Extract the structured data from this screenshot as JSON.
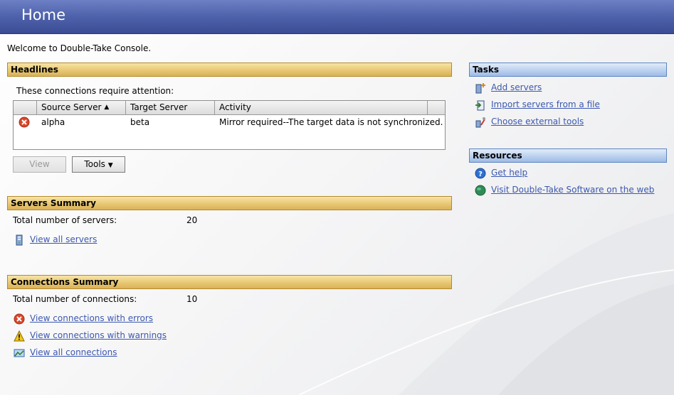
{
  "header": {
    "title": "Home"
  },
  "welcome": "Welcome to Double-Take Console.",
  "headlines": {
    "title": "Headlines",
    "subtitle": "These connections require attention:",
    "columns": [
      "Source Server",
      "Target Server",
      "Activity"
    ],
    "rows": [
      {
        "status": "error",
        "source": "alpha",
        "target": "beta",
        "activity": "Mirror required--The target data is not synchronized."
      }
    ],
    "view_button": "View",
    "tools_button": "Tools"
  },
  "servers_summary": {
    "title": "Servers Summary",
    "total_label": "Total number of servers:",
    "total_value": "20",
    "view_all_link": "View all servers"
  },
  "connections_summary": {
    "title": "Connections Summary",
    "total_label": "Total number of connections:",
    "total_value": "10",
    "errors_link": "View connections with errors",
    "warnings_link": "View connections with warnings",
    "all_link": "View all connections"
  },
  "tasks": {
    "title": "Tasks",
    "items": [
      "Add servers",
      "Import servers from a file",
      "Choose external tools"
    ]
  },
  "resources": {
    "title": "Resources",
    "items": [
      "Get help",
      "Visit Double-Take Software on the web"
    ]
  },
  "colors": {
    "header": "#4a5ea6",
    "section_gold": "#e8c874",
    "section_blue": "#bcd1f0",
    "link": "#3c58ad",
    "error": "#d9482b",
    "warning": "#f2c81c"
  }
}
